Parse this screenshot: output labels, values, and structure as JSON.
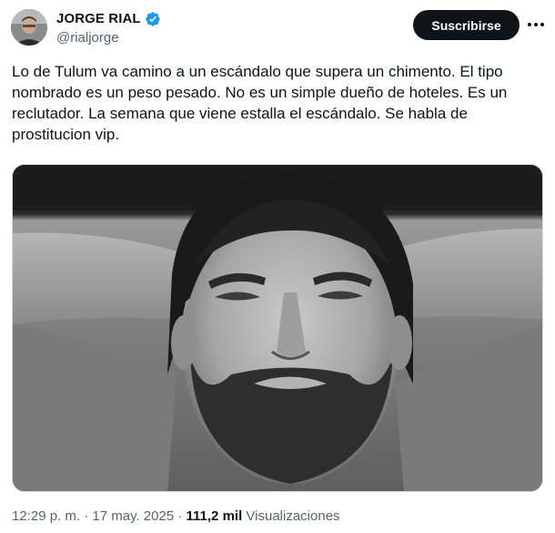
{
  "author": {
    "display_name": "JORGE RIAL",
    "handle": "@rialjorge",
    "verified": true,
    "verified_color": "#1d9bf0"
  },
  "actions": {
    "subscribe_label": "Suscribirse"
  },
  "tweet": {
    "text": "Lo de Tulum va camino a un escándalo que supera un chimento. El tipo\nnombrado es un peso pesado. No es un simple dueño de hoteles. Es un\nreclutador. La semana que viene estalla el escándalo. Se habla de\nprostitucion vip."
  },
  "meta": {
    "time": "12:29 p. m.",
    "separator1": " · ",
    "date": "17 may. 2025",
    "separator2": " · ",
    "views_count": "111,2 mil",
    "views_label": "Visualizaciones"
  },
  "icons": {
    "verified": "verified-badge-icon",
    "more": "more-options-icon"
  },
  "colors": {
    "text": "#0f1419",
    "secondary_text": "#536471",
    "button_bg": "#0f1419"
  }
}
